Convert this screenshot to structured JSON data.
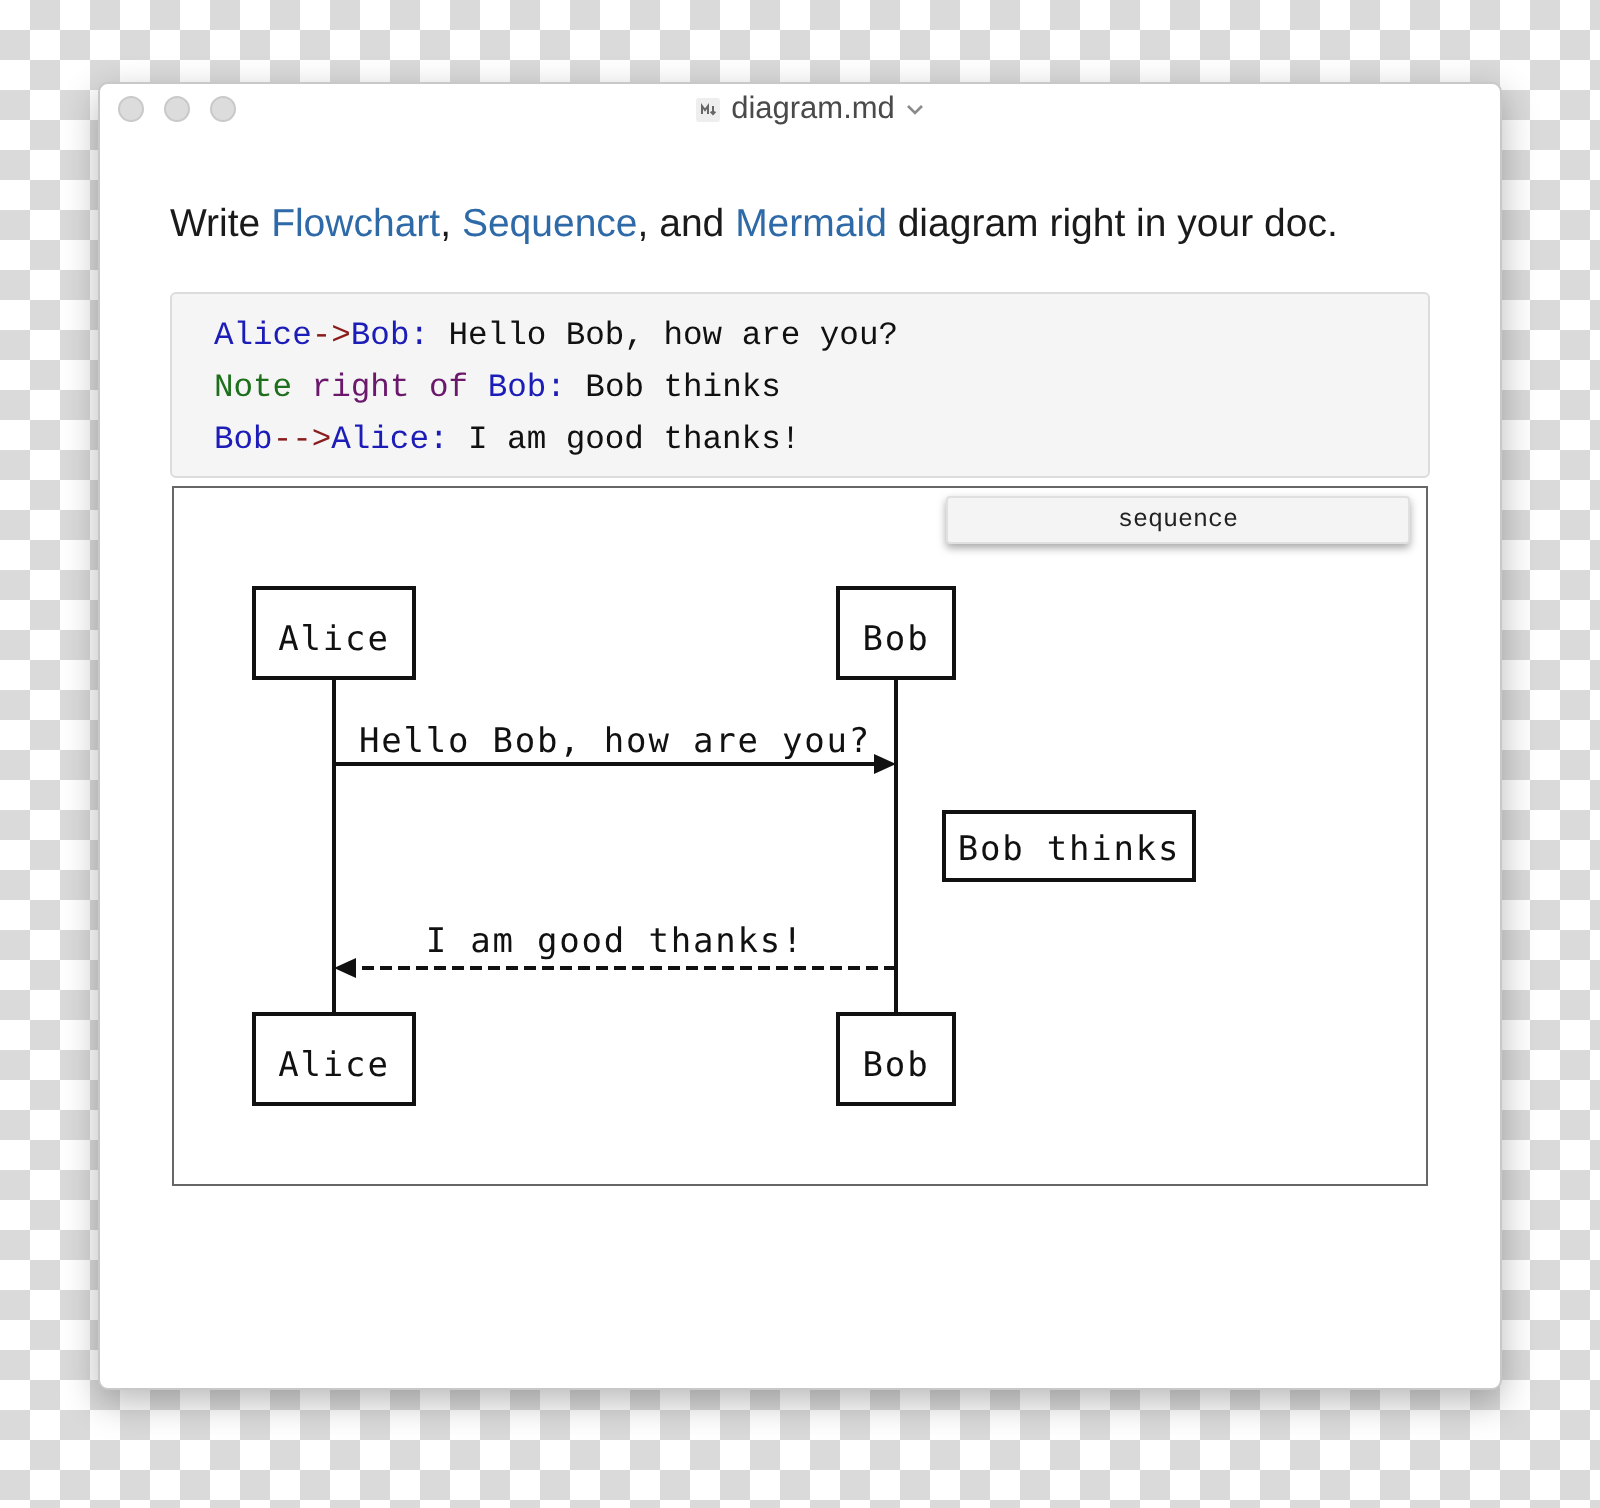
{
  "window": {
    "title": "diagram.md"
  },
  "intro": [
    {
      "kind": "plain",
      "text": "Write "
    },
    {
      "kind": "link",
      "text": "Flowchart"
    },
    {
      "kind": "plain",
      "text": ", "
    },
    {
      "kind": "link",
      "text": "Sequence"
    },
    {
      "kind": "plain",
      "text": ", and "
    },
    {
      "kind": "link",
      "text": "Mermaid"
    },
    {
      "kind": "plain",
      "text": " diagram right in your doc."
    }
  ],
  "code": [
    [
      {
        "kind": "name",
        "text": "Alice"
      },
      {
        "kind": "operator",
        "text": "->"
      },
      {
        "kind": "name",
        "text": "Bob:"
      },
      {
        "kind": "text",
        "text": " Hello Bob, how are you?"
      }
    ],
    [
      {
        "kind": "note",
        "text": "Note"
      },
      {
        "kind": "keyword",
        "text": " right of "
      },
      {
        "kind": "name",
        "text": "Bob:"
      },
      {
        "kind": "text",
        "text": " Bob thinks"
      }
    ],
    [
      {
        "kind": "name",
        "text": "Bob"
      },
      {
        "kind": "operator",
        "text": "-->"
      },
      {
        "kind": "name",
        "text": "Alice:"
      },
      {
        "kind": "text",
        "text": " I am good thanks!"
      }
    ]
  ],
  "diagram": {
    "mode_button": "sequence",
    "participants_top": [
      "Alice",
      "Bob"
    ],
    "participants_bottom": [
      "Alice",
      "Bob"
    ],
    "messages": [
      {
        "text": "Hello Bob, how are you?",
        "kind": "request"
      },
      {
        "text": "I am good thanks!",
        "kind": "reply"
      }
    ],
    "note": "Bob thinks"
  }
}
